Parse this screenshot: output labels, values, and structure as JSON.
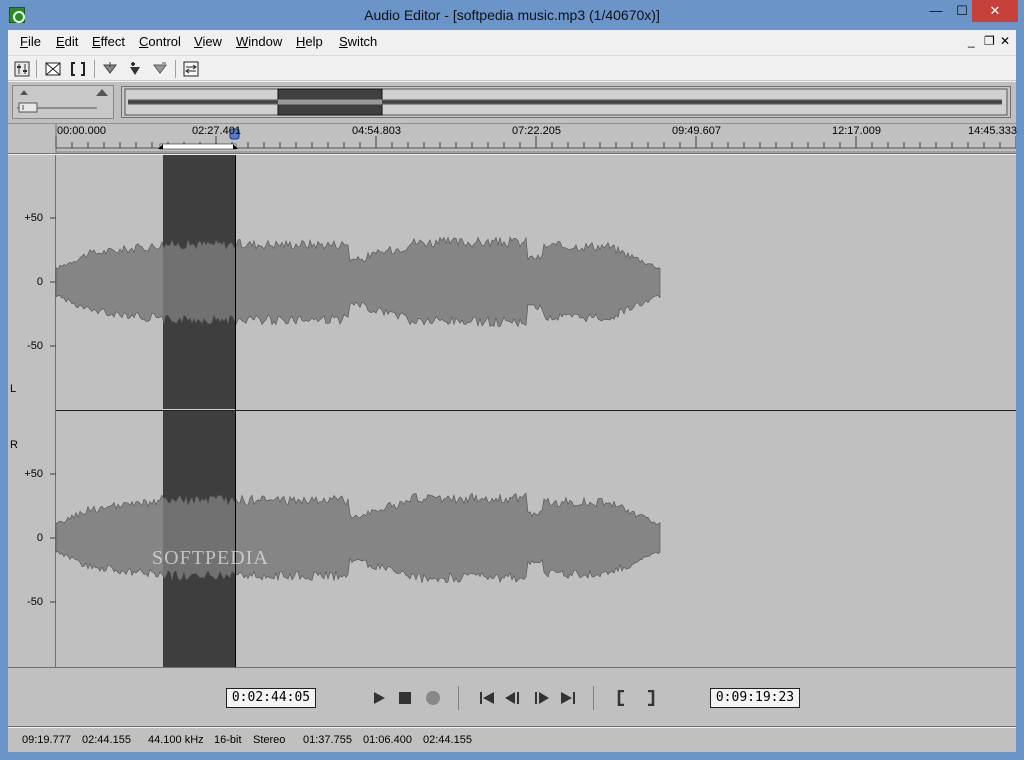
{
  "window": {
    "title": "Audio Editor - [softpedia music.mp3 (1/40670x)]",
    "min_glyph": "—",
    "max_glyph": "☐",
    "close_glyph": "✕"
  },
  "menu": {
    "items": [
      "File",
      "Edit",
      "Effect",
      "Control",
      "View",
      "Window",
      "Help",
      "Switch"
    ],
    "mdi_min": "_",
    "mdi_restore": "❐",
    "mdi_close": "✕"
  },
  "ruler": {
    "ticks": [
      "00:00.000",
      "02:27.401",
      "04:54.803",
      "07:22.205",
      "09:49.607",
      "12:17.009",
      "14:45.333"
    ]
  },
  "scale": {
    "top": [
      "+50",
      "0",
      "-50"
    ],
    "bottom": [
      "+50",
      "0",
      "-50"
    ],
    "left_channel": "L",
    "right_channel": "R"
  },
  "watermark": "SOFTPEDIA",
  "transport": {
    "start_time": "0:02:44:05",
    "end_time": "0:09:19:23"
  },
  "status": {
    "cells": [
      "09:19.777",
      "02:44.155",
      "44.100 kHz",
      "16-bit",
      "Stereo",
      "01:37.755",
      "01:06.400",
      "02:44.155"
    ]
  },
  "colors": {
    "waveform": "#7a7a7a",
    "selection": "#3e3e3e",
    "background": "#c0c0c0"
  }
}
